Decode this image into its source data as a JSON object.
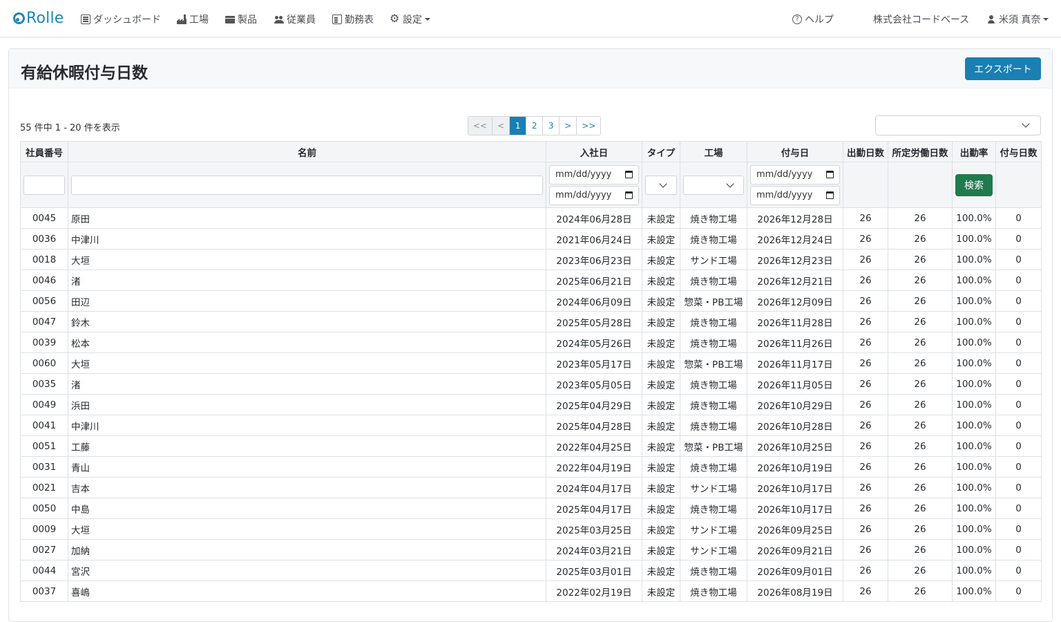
{
  "app": {
    "brand": "Rolle"
  },
  "nav": {
    "items": [
      {
        "label": "ダッシュボード",
        "icon": "dashboard-icon"
      },
      {
        "label": "工場",
        "icon": "factory-icon"
      },
      {
        "label": "製品",
        "icon": "box-icon"
      },
      {
        "label": "従業員",
        "icon": "users-icon"
      },
      {
        "label": "勤務表",
        "icon": "sheet-icon"
      },
      {
        "label": "設定",
        "icon": "gear-icon"
      }
    ],
    "help": "ヘルプ",
    "company": "株式会社コードベース",
    "user": "米須 真奈"
  },
  "page": {
    "title": "有給休暇付与日数",
    "export_label": "エクスポート",
    "count_text": "55 件中 1 - 20 件を表示"
  },
  "pagination": {
    "first": "<<",
    "prev": "<",
    "pages": [
      "1",
      "2",
      "3"
    ],
    "next": ">",
    "last": ">>",
    "current": "1"
  },
  "table": {
    "headers": [
      "社員番号",
      "名前",
      "入社日",
      "タイプ",
      "工場",
      "付与日",
      "出勤日数",
      "所定労働日数",
      "出勤率",
      "付与日数"
    ],
    "date_placeholder": "mm/dd/yyyy",
    "search_label": "検索",
    "rows": [
      [
        "0045",
        "原田",
        "2024年06月28日",
        "未設定",
        "焼き物工場",
        "2026年12月28日",
        "26",
        "26",
        "100.0%",
        "0"
      ],
      [
        "0036",
        "中津川",
        "2021年06月24日",
        "未設定",
        "焼き物工場",
        "2026年12月24日",
        "26",
        "26",
        "100.0%",
        "0"
      ],
      [
        "0018",
        "大垣",
        "2023年06月23日",
        "未設定",
        "サンド工場",
        "2026年12月23日",
        "26",
        "26",
        "100.0%",
        "0"
      ],
      [
        "0046",
        "渚",
        "2025年06月21日",
        "未設定",
        "焼き物工場",
        "2026年12月21日",
        "26",
        "26",
        "100.0%",
        "0"
      ],
      [
        "0056",
        "田辺",
        "2024年06月09日",
        "未設定",
        "惣菜・PB工場",
        "2026年12月09日",
        "26",
        "26",
        "100.0%",
        "0"
      ],
      [
        "0047",
        "鈴木",
        "2025年05月28日",
        "未設定",
        "焼き物工場",
        "2026年11月28日",
        "26",
        "26",
        "100.0%",
        "0"
      ],
      [
        "0039",
        "松本",
        "2024年05月26日",
        "未設定",
        "焼き物工場",
        "2026年11月26日",
        "26",
        "26",
        "100.0%",
        "0"
      ],
      [
        "0060",
        "大垣",
        "2023年05月17日",
        "未設定",
        "惣菜・PB工場",
        "2026年11月17日",
        "26",
        "26",
        "100.0%",
        "0"
      ],
      [
        "0035",
        "渚",
        "2023年05月05日",
        "未設定",
        "焼き物工場",
        "2026年11月05日",
        "26",
        "26",
        "100.0%",
        "0"
      ],
      [
        "0049",
        "浜田",
        "2025年04月29日",
        "未設定",
        "焼き物工場",
        "2026年10月29日",
        "26",
        "26",
        "100.0%",
        "0"
      ],
      [
        "0041",
        "中津川",
        "2025年04月28日",
        "未設定",
        "焼き物工場",
        "2026年10月28日",
        "26",
        "26",
        "100.0%",
        "0"
      ],
      [
        "0051",
        "工藤",
        "2022年04月25日",
        "未設定",
        "惣菜・PB工場",
        "2026年10月25日",
        "26",
        "26",
        "100.0%",
        "0"
      ],
      [
        "0031",
        "青山",
        "2022年04月19日",
        "未設定",
        "焼き物工場",
        "2026年10月19日",
        "26",
        "26",
        "100.0%",
        "0"
      ],
      [
        "0021",
        "吉本",
        "2024年04月17日",
        "未設定",
        "サンド工場",
        "2026年10月17日",
        "26",
        "26",
        "100.0%",
        "0"
      ],
      [
        "0050",
        "中島",
        "2025年04月17日",
        "未設定",
        "焼き物工場",
        "2026年10月17日",
        "26",
        "26",
        "100.0%",
        "0"
      ],
      [
        "0009",
        "大垣",
        "2025年03月25日",
        "未設定",
        "サンド工場",
        "2026年09月25日",
        "26",
        "26",
        "100.0%",
        "0"
      ],
      [
        "0027",
        "加納",
        "2024年03月21日",
        "未設定",
        "サンド工場",
        "2026年09月21日",
        "26",
        "26",
        "100.0%",
        "0"
      ],
      [
        "0044",
        "宮沢",
        "2025年03月01日",
        "未設定",
        "焼き物工場",
        "2026年09月01日",
        "26",
        "26",
        "100.0%",
        "0"
      ],
      [
        "0037",
        "喜嶋",
        "2022年02月19日",
        "未設定",
        "焼き物工場",
        "2026年08月19日",
        "26",
        "26",
        "100.0%",
        "0"
      ]
    ]
  },
  "colors": {
    "primary": "#1a7fb3",
    "success": "#1f7a4d",
    "header_bg": "#f4f5f7"
  }
}
